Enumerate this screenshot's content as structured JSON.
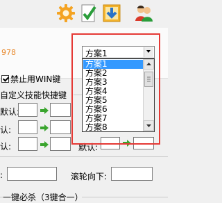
{
  "toolbar": {
    "icons": [
      "gear-icon",
      "document-check-icon",
      "download-icon",
      "users-icon"
    ]
  },
  "top_panel": {
    "number_text": "978"
  },
  "settings": {
    "disable_win_label": "禁止用WIN键",
    "custom_skill_header": "自定义技能快捷键",
    "row_label_default": "默认:",
    "row_label_confirm": "认:"
  },
  "scheme_selector": {
    "selected": "方案1",
    "options": [
      "方案1",
      "方案2",
      "方案3",
      "方案4",
      "方案5",
      "方案6",
      "方案7",
      "方案8"
    ]
  },
  "bottom": {
    "colon_label": ":",
    "wheel_down_label": "滚轮向下:",
    "one_key_kill_label": "一键必杀（3键合一）"
  },
  "colors": {
    "accent_red": "#e53935",
    "selection_blue": "#3399ff",
    "number_orange": "#e88a2e",
    "arrow_green": "#3aa52e"
  }
}
